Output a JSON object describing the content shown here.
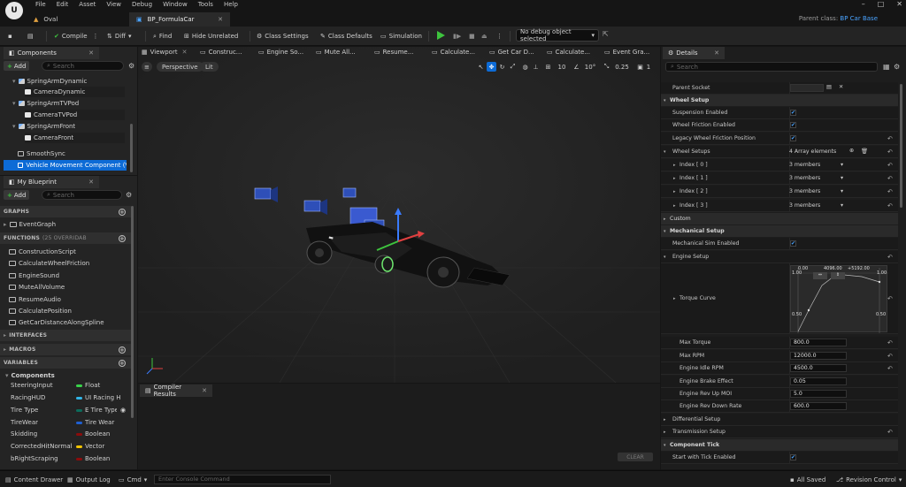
{
  "menu": [
    "File",
    "Edit",
    "Asset",
    "View",
    "Debug",
    "Window",
    "Tools",
    "Help"
  ],
  "logo": "U",
  "doc_tabs": {
    "tab1": "Oval",
    "tab2": "BP_FormulaCar"
  },
  "parent_class": {
    "label": "Parent class:",
    "value": "BP Car Base"
  },
  "toolbar": {
    "compile": "Compile",
    "diff": "Diff",
    "find": "Find",
    "hide_unrelated": "Hide Unrelated",
    "class_settings": "Class Settings",
    "class_defaults": "Class Defaults",
    "simulation": "Simulation",
    "debug_object": "No debug object selected"
  },
  "components": {
    "tab": "Components",
    "add": "Add",
    "search_placeholder": "Search",
    "items": [
      "SpringArmDynamic",
      "CameraDynamic",
      "SpringArmTVPod",
      "CameraTVPod",
      "SpringArmFront",
      "CameraFront",
      "SmoothSync",
      "Vehicle Movement Component (Vehic"
    ]
  },
  "my_blueprint": {
    "tab": "My Blueprint",
    "add": "Add",
    "search_placeholder": "Search",
    "graphs_label": "GRAPHS",
    "event_graph": "EventGraph",
    "functions_label": "FUNCTIONS",
    "functions_count": "(25 OVERRIDAB",
    "functions": [
      "ConstructionScript",
      "CalculateWheelFriction",
      "EngineSound",
      "MuteAllVolume",
      "ResumeAudio",
      "CalculatePosition",
      "GetCarDistanceAlongSpline"
    ],
    "interfaces_label": "INTERFACES",
    "macros_label": "MACROS",
    "variables_label": "VARIABLES",
    "components_group": "Components",
    "variables": [
      {
        "name": "SteeringInput",
        "type": "Float",
        "color": "#39d34a"
      },
      {
        "name": "RacingHUD",
        "type": "UI Racing H",
        "color": "#31b5e8"
      },
      {
        "name": "Tire Type",
        "type": "E Tire Type",
        "color": "#0b6c5c"
      },
      {
        "name": "TireWear",
        "type": "Tire Wear",
        "color": "#1f5fd1"
      },
      {
        "name": "Skidding",
        "type": "Boolean",
        "color": "#8b0c0c"
      },
      {
        "name": "CorrectedHitNormal",
        "type": "Vector",
        "color": "#f2c400"
      },
      {
        "name": "bRightScraping",
        "type": "Boolean",
        "color": "#8b0c0c"
      }
    ]
  },
  "viewport": {
    "tabs": [
      "Viewport",
      "Construc...",
      "Engine So...",
      "Mute All...",
      "Resume...",
      "Calculate...",
      "Get Car D...",
      "Calculate...",
      "Event Gra..."
    ],
    "perspective": "Perspective",
    "lit": "Lit",
    "grid_snap": "10",
    "rot_snap": "10°",
    "scale_snap": "0.25",
    "cam_speed": "1"
  },
  "compiler": {
    "tab": "Compiler Results",
    "clear": "CLEAR"
  },
  "details": {
    "tab": "Details",
    "search_placeholder": "Search",
    "parent_socket": "Parent Socket",
    "wheel_setup": "Wheel Setup",
    "suspension": "Suspension Enabled",
    "wheel_friction": "Wheel Friction Enabled",
    "legacy_friction": "Legacy Wheel Friction Position",
    "wheel_setups": "Wheel Setups",
    "array_elements": "4 Array elements",
    "indices": [
      "Index [ 0 ]",
      "Index [ 1 ]",
      "Index [ 2 ]",
      "Index [ 3 ]"
    ],
    "members": "3 members",
    "custom": "Custom",
    "mechanical_setup": "Mechanical Setup",
    "mech_sim": "Mechanical Sim Enabled",
    "engine_setup": "Engine Setup",
    "torque_curve": "Torque Curve",
    "curve_labels": {
      "tl": "0.00",
      "tm": "4096.00",
      "tr": "+5192.00",
      "y1": "1.00",
      "y1r": "1.00",
      "y05": "0.50",
      "y05r": "0.50"
    },
    "fields": [
      {
        "label": "Max Torque",
        "value": "800.0"
      },
      {
        "label": "Max RPM",
        "value": "12000.0"
      },
      {
        "label": "Engine Idle RPM",
        "value": "4500.0"
      },
      {
        "label": "Engine Brake Effect",
        "value": "0.05"
      },
      {
        "label": "Engine Rev Up MOI",
        "value": "5.0"
      },
      {
        "label": "Engine Rev Down Rate",
        "value": "600.0"
      }
    ],
    "differential": "Differential Setup",
    "transmission": "Transmission Setup",
    "component_tick": "Component Tick",
    "start_tick": "Start with Tick Enabled"
  },
  "bottom": {
    "content_drawer": "Content Drawer",
    "output_log": "Output Log",
    "cmd": "Cmd",
    "console_placeholder": "Enter Console Command",
    "all_saved": "All Saved",
    "revision": "Revision Control"
  }
}
